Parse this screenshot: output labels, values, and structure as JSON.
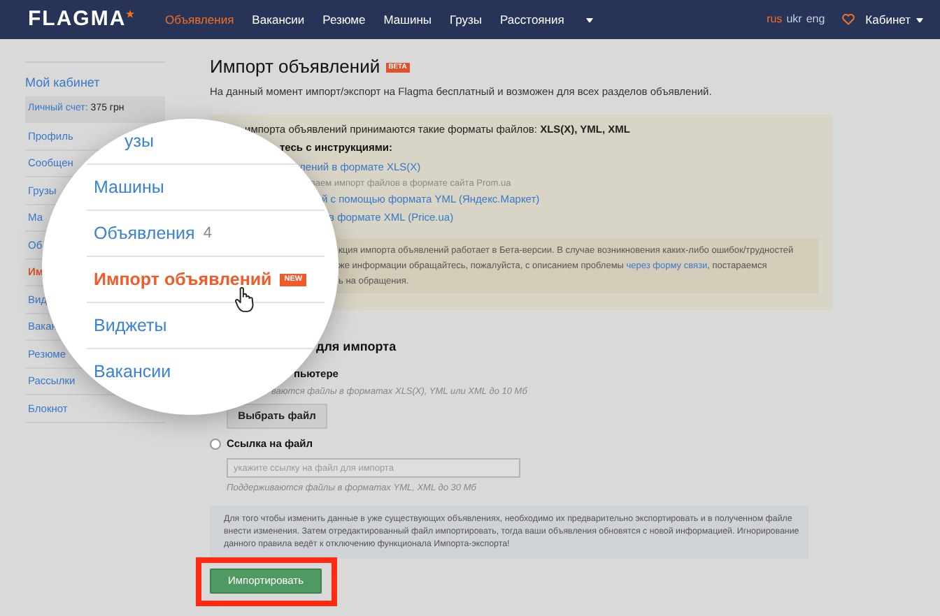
{
  "header": {
    "logo": "FLAGMA",
    "nav": [
      {
        "label": "Объявления",
        "selected": true
      },
      {
        "label": "Вакансии",
        "selected": false
      },
      {
        "label": "Резюме",
        "selected": false
      },
      {
        "label": "Машины",
        "selected": false
      },
      {
        "label": "Грузы",
        "selected": false
      },
      {
        "label": "Расстояния",
        "selected": false
      }
    ],
    "languages": [
      {
        "label": "rus",
        "selected": true
      },
      {
        "label": "ukr",
        "selected": false
      },
      {
        "label": "eng",
        "selected": false
      }
    ],
    "account_menu": "Кабинет"
  },
  "sidebar": {
    "title": "Мой кабинет",
    "balance": {
      "label": "Личный счет:",
      "value": "375 грн"
    },
    "items": [
      {
        "label": "Профиль",
        "selected": false
      },
      {
        "label": "Сообщен",
        "selected": false
      },
      {
        "label": "Грузы",
        "selected": false
      },
      {
        "label": "Ма",
        "selected": false
      },
      {
        "label": "Об",
        "selected": false
      },
      {
        "label": "Им",
        "selected": true
      },
      {
        "label": "Вид",
        "selected": false
      },
      {
        "label": "Вакан",
        "selected": false
      },
      {
        "label": "Резюме",
        "selected": false
      },
      {
        "label": "Рассылки",
        "selected": false
      },
      {
        "label": "Блокнот",
        "selected": false
      }
    ]
  },
  "main": {
    "title": "Импорт объявлений",
    "badge": "BETA",
    "intro": "На данный момент импорт/экспорт на Flagma бесплатный и возможен для всех разделов объявлений.",
    "notice": {
      "lines": [
        {
          "kind": "text",
          "text": "импорта объявлений принимаются такие форматы файлов: **XLS(X), YML, XML**"
        },
        {
          "kind": "heading",
          "text": "тесь с инструкциями:"
        },
        {
          "kind": "link",
          "text": "лений в формате XLS(X)"
        },
        {
          "kind": "hint",
          "text": "ваем импорт файлов в формате сайта Prom.ua"
        },
        {
          "kind": "link",
          "text": "й с помощью формата YML (Яндекс.Маркет)"
        },
        {
          "kind": "link",
          "text": "в формате XML (Price.ua)"
        }
      ],
      "warning": [
        [
          {
            "kind": "text",
            "text": "кция импорта объявлений работает в Бета-версии. В случае возникновения каких-либо ошибок/трудностей"
          }
        ],
        [
          {
            "kind": "text",
            "text": "же информации обращайтесь, пожалуйста, с описанием проблемы "
          },
          {
            "kind": "link",
            "text": "через форму связи"
          },
          {
            "kind": "text",
            "text": ", постараемся"
          }
        ],
        [
          {
            "kind": "text",
            "text": "ь на обращения."
          }
        ]
      ]
    },
    "form": {
      "heading": "для импорта",
      "computer_option": {
        "label": "пьютере",
        "hint": "ваются файлы в форматах XLS(X), YML или XML до 10 Мб",
        "button": "Выбрать файл"
      },
      "link_option": {
        "label": "Ссылка на файл",
        "selected": false,
        "placeholder": "укажите ссылку на файл для импорта",
        "hint": "Поддерживаются файлы в форматах YML, XML до 30 Мб"
      },
      "info": "Для того чтобы изменить данные в уже существующих объявлениях, необходимо их предварительно экспортировать и в полученном файле внести изменения. Затем отредактированный файл импортировать, тогда ваши объявления обновятся с новой информацией. Игнорирование данного правила ведёт к отключению функционала Импорта-экспорта!",
      "submit": "Импортировать"
    }
  },
  "magnifier": {
    "items": [
      {
        "label": "узы",
        "selected": false
      },
      {
        "label": "Машины",
        "selected": false
      },
      {
        "label": "Объявления",
        "count": "4",
        "selected": false
      },
      {
        "label": "Импорт объявлений",
        "badge": "NEW",
        "selected": true
      },
      {
        "label": "Виджеты",
        "selected": false
      },
      {
        "label": "Вакансии",
        "selected": false
      }
    ]
  }
}
